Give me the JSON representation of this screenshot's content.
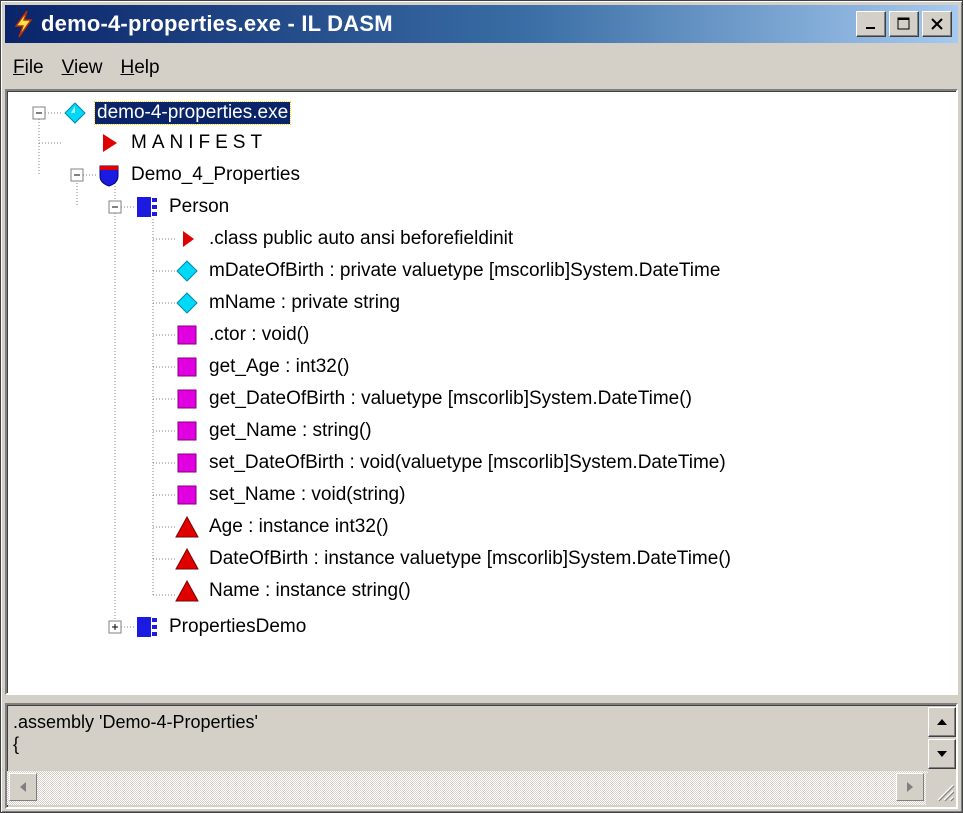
{
  "window": {
    "title": "demo-4-properties.exe - IL DASM"
  },
  "menu": [
    {
      "prefix": "",
      "accel": "F",
      "rest": "ile"
    },
    {
      "prefix": "",
      "accel": "V",
      "rest": "iew"
    },
    {
      "prefix": "",
      "accel": "H",
      "rest": "elp"
    }
  ],
  "tree": {
    "root": "demo-4-properties.exe",
    "manifest": "MANIFEST",
    "namespace": "Demo_4_Properties",
    "class_person": "Person",
    "members": [
      ".class public auto ansi beforefieldinit",
      "mDateOfBirth : private valuetype [mscorlib]System.DateTime",
      "mName : private string",
      ".ctor : void()",
      "get_Age : int32()",
      "get_DateOfBirth : valuetype [mscorlib]System.DateTime()",
      "get_Name : string()",
      "set_DateOfBirth : void(valuetype [mscorlib]System.DateTime)",
      "set_Name : void(string)",
      "Age : instance int32()",
      "DateOfBirth : instance valuetype [mscorlib]System.DateTime()",
      "Name : instance string()"
    ],
    "class_demo": "PropertiesDemo"
  },
  "code": {
    "line1": ".assembly 'Demo-4-Properties'",
    "line2": "{"
  },
  "colors": {
    "titlebar_start": "#0a246a",
    "titlebar_end": "#a6caf0",
    "selection": "#0a246a",
    "manifest_red": "#e00000",
    "field_cyan": "#00c8f0",
    "method_magenta": "#e000e0",
    "class_blue": "#0000e0",
    "property_red": "#e00000"
  }
}
